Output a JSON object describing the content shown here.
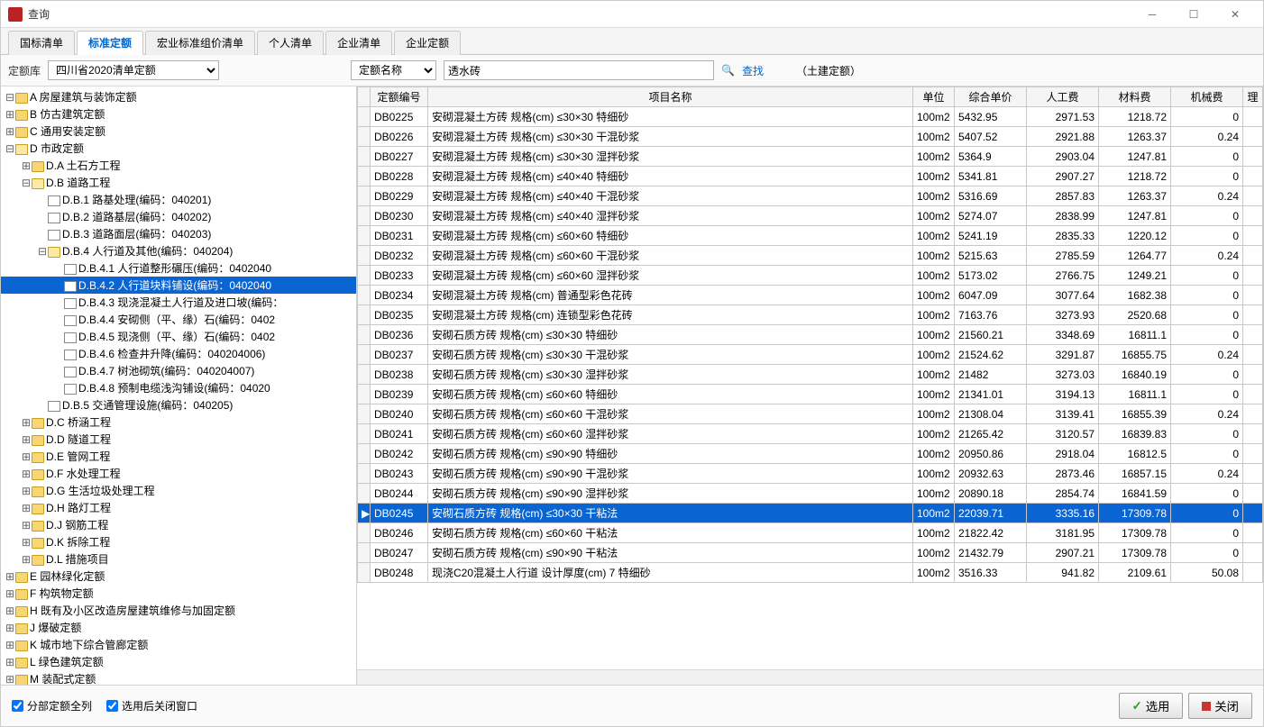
{
  "window": {
    "title": "查询"
  },
  "tabs": [
    "国标清单",
    "标准定额",
    "宏业标准组价清单",
    "个人清单",
    "企业清单",
    "企业定额"
  ],
  "activeTab": 1,
  "toolbar": {
    "left_label": "定额库",
    "library": "四川省2020清单定额",
    "filter_type": "定额名称",
    "filter_value": "透水砖",
    "search_label": "查找",
    "extra": "（土建定额）"
  },
  "tree": [
    {
      "indent": 0,
      "toggle": "-",
      "type": "folder",
      "label": "A 房屋建筑与装饰定额"
    },
    {
      "indent": 0,
      "toggle": "+",
      "type": "folder",
      "label": "B 仿古建筑定额"
    },
    {
      "indent": 0,
      "toggle": "+",
      "type": "folder",
      "label": "C 通用安装定额"
    },
    {
      "indent": 0,
      "toggle": "-",
      "type": "folder-open",
      "label": "D 市政定额"
    },
    {
      "indent": 1,
      "toggle": "+",
      "type": "folder",
      "label": "D.A 土石方工程"
    },
    {
      "indent": 1,
      "toggle": "-",
      "type": "folder-open",
      "label": "D.B 道路工程"
    },
    {
      "indent": 2,
      "toggle": "",
      "type": "doc",
      "label": "D.B.1 路基处理(编码：040201)"
    },
    {
      "indent": 2,
      "toggle": "",
      "type": "doc",
      "label": "D.B.2 道路基层(编码：040202)"
    },
    {
      "indent": 2,
      "toggle": "",
      "type": "doc",
      "label": "D.B.3 道路面层(编码：040203)"
    },
    {
      "indent": 2,
      "toggle": "-",
      "type": "folder-open",
      "label": "D.B.4 人行道及其他(编码：040204)"
    },
    {
      "indent": 3,
      "toggle": "",
      "type": "doc",
      "label": "D.B.4.1 人行道整形碾压(编码：0402040"
    },
    {
      "indent": 3,
      "toggle": "",
      "type": "doc",
      "label": "D.B.4.2 人行道块料铺设(编码：0402040",
      "selected": true
    },
    {
      "indent": 3,
      "toggle": "",
      "type": "doc",
      "label": "D.B.4.3 现浇混凝土人行道及进口坡(编码："
    },
    {
      "indent": 3,
      "toggle": "",
      "type": "doc",
      "label": "D.B.4.4 安砌侧（平、缘）石(编码：0402"
    },
    {
      "indent": 3,
      "toggle": "",
      "type": "doc",
      "label": "D.B.4.5 现浇侧（平、缘）石(编码：0402"
    },
    {
      "indent": 3,
      "toggle": "",
      "type": "doc",
      "label": "D.B.4.6 检查井升降(编码：040204006)"
    },
    {
      "indent": 3,
      "toggle": "",
      "type": "doc",
      "label": "D.B.4.7 树池砌筑(编码：040204007)"
    },
    {
      "indent": 3,
      "toggle": "",
      "type": "doc",
      "label": "D.B.4.8 预制电缆浅沟铺设(编码：04020"
    },
    {
      "indent": 2,
      "toggle": "",
      "type": "doc",
      "label": "D.B.5 交通管理设施(编码：040205)"
    },
    {
      "indent": 1,
      "toggle": "+",
      "type": "folder",
      "label": "D.C 桥涵工程"
    },
    {
      "indent": 1,
      "toggle": "+",
      "type": "folder",
      "label": "D.D 隧道工程"
    },
    {
      "indent": 1,
      "toggle": "+",
      "type": "folder",
      "label": "D.E 管网工程"
    },
    {
      "indent": 1,
      "toggle": "+",
      "type": "folder",
      "label": "D.F 水处理工程"
    },
    {
      "indent": 1,
      "toggle": "+",
      "type": "folder",
      "label": "D.G 生活垃圾处理工程"
    },
    {
      "indent": 1,
      "toggle": "+",
      "type": "folder",
      "label": "D.H 路灯工程"
    },
    {
      "indent": 1,
      "toggle": "+",
      "type": "folder",
      "label": "D.J 钢筋工程"
    },
    {
      "indent": 1,
      "toggle": "+",
      "type": "folder",
      "label": "D.K 拆除工程"
    },
    {
      "indent": 1,
      "toggle": "+",
      "type": "folder",
      "label": "D.L 措施项目"
    },
    {
      "indent": 0,
      "toggle": "+",
      "type": "folder",
      "label": "E 园林绿化定额"
    },
    {
      "indent": 0,
      "toggle": "+",
      "type": "folder",
      "label": "F 构筑物定额"
    },
    {
      "indent": 0,
      "toggle": "+",
      "type": "folder",
      "label": "H 既有及小区改造房屋建筑维修与加固定额"
    },
    {
      "indent": 0,
      "toggle": "+",
      "type": "folder",
      "label": "J 爆破定额"
    },
    {
      "indent": 0,
      "toggle": "+",
      "type": "folder",
      "label": "K 城市地下综合管廊定额"
    },
    {
      "indent": 0,
      "toggle": "+",
      "type": "folder",
      "label": "L 绿色建筑定额"
    },
    {
      "indent": 0,
      "toggle": "+",
      "type": "folder",
      "label": "M 装配式定额"
    }
  ],
  "table": {
    "headers": [
      "定额编号",
      "项目名称",
      "单位",
      "综合单价",
      "人工费",
      "材料费",
      "机械费",
      "理"
    ],
    "rows": [
      {
        "code": "DB0225",
        "name": "安砌混凝土方砖 规格(cm) ≤30×30 特细砂",
        "unit": "100m2",
        "price": "5432.95",
        "labor": "2971.53",
        "material": "1218.72",
        "machine": "0"
      },
      {
        "code": "DB0226",
        "name": "安砌混凝土方砖 规格(cm) ≤30×30 干混砂浆",
        "unit": "100m2",
        "price": "5407.52",
        "labor": "2921.88",
        "material": "1263.37",
        "machine": "0.24"
      },
      {
        "code": "DB0227",
        "name": "安砌混凝土方砖 规格(cm) ≤30×30 湿拌砂浆",
        "unit": "100m2",
        "price": "5364.9",
        "labor": "2903.04",
        "material": "1247.81",
        "machine": "0"
      },
      {
        "code": "DB0228",
        "name": "安砌混凝土方砖 规格(cm) ≤40×40 特细砂",
        "unit": "100m2",
        "price": "5341.81",
        "labor": "2907.27",
        "material": "1218.72",
        "machine": "0"
      },
      {
        "code": "DB0229",
        "name": "安砌混凝土方砖 规格(cm) ≤40×40 干混砂浆",
        "unit": "100m2",
        "price": "5316.69",
        "labor": "2857.83",
        "material": "1263.37",
        "machine": "0.24"
      },
      {
        "code": "DB0230",
        "name": "安砌混凝土方砖 规格(cm) ≤40×40 湿拌砂浆",
        "unit": "100m2",
        "price": "5274.07",
        "labor": "2838.99",
        "material": "1247.81",
        "machine": "0"
      },
      {
        "code": "DB0231",
        "name": "安砌混凝土方砖 规格(cm) ≤60×60 特细砂",
        "unit": "100m2",
        "price": "5241.19",
        "labor": "2835.33",
        "material": "1220.12",
        "machine": "0"
      },
      {
        "code": "DB0232",
        "name": "安砌混凝土方砖 规格(cm) ≤60×60 干混砂浆",
        "unit": "100m2",
        "price": "5215.63",
        "labor": "2785.59",
        "material": "1264.77",
        "machine": "0.24"
      },
      {
        "code": "DB0233",
        "name": "安砌混凝土方砖 规格(cm) ≤60×60 湿拌砂浆",
        "unit": "100m2",
        "price": "5173.02",
        "labor": "2766.75",
        "material": "1249.21",
        "machine": "0"
      },
      {
        "code": "DB0234",
        "name": "安砌混凝土方砖 规格(cm) 普通型彩色花砖",
        "unit": "100m2",
        "price": "6047.09",
        "labor": "3077.64",
        "material": "1682.38",
        "machine": "0"
      },
      {
        "code": "DB0235",
        "name": "安砌混凝土方砖 规格(cm) 连锁型彩色花砖",
        "unit": "100m2",
        "price": "7163.76",
        "labor": "3273.93",
        "material": "2520.68",
        "machine": "0"
      },
      {
        "code": "DB0236",
        "name": "安砌石质方砖 规格(cm) ≤30×30 特细砂",
        "unit": "100m2",
        "price": "21560.21",
        "labor": "3348.69",
        "material": "16811.1",
        "machine": "0"
      },
      {
        "code": "DB0237",
        "name": "安砌石质方砖 规格(cm) ≤30×30 干混砂浆",
        "unit": "100m2",
        "price": "21524.62",
        "labor": "3291.87",
        "material": "16855.75",
        "machine": "0.24"
      },
      {
        "code": "DB0238",
        "name": "安砌石质方砖 规格(cm) ≤30×30 湿拌砂浆",
        "unit": "100m2",
        "price": "21482",
        "labor": "3273.03",
        "material": "16840.19",
        "machine": "0"
      },
      {
        "code": "DB0239",
        "name": "安砌石质方砖 规格(cm) ≤60×60 特细砂",
        "unit": "100m2",
        "price": "21341.01",
        "labor": "3194.13",
        "material": "16811.1",
        "machine": "0"
      },
      {
        "code": "DB0240",
        "name": "安砌石质方砖 规格(cm) ≤60×60 干混砂浆",
        "unit": "100m2",
        "price": "21308.04",
        "labor": "3139.41",
        "material": "16855.39",
        "machine": "0.24"
      },
      {
        "code": "DB0241",
        "name": "安砌石质方砖 规格(cm) ≤60×60 湿拌砂浆",
        "unit": "100m2",
        "price": "21265.42",
        "labor": "3120.57",
        "material": "16839.83",
        "machine": "0"
      },
      {
        "code": "DB0242",
        "name": "安砌石质方砖 规格(cm) ≤90×90 特细砂",
        "unit": "100m2",
        "price": "20950.86",
        "labor": "2918.04",
        "material": "16812.5",
        "machine": "0"
      },
      {
        "code": "DB0243",
        "name": "安砌石质方砖 规格(cm) ≤90×90 干混砂浆",
        "unit": "100m2",
        "price": "20932.63",
        "labor": "2873.46",
        "material": "16857.15",
        "machine": "0.24"
      },
      {
        "code": "DB0244",
        "name": "安砌石质方砖 规格(cm) ≤90×90 湿拌砂浆",
        "unit": "100m2",
        "price": "20890.18",
        "labor": "2854.74",
        "material": "16841.59",
        "machine": "0"
      },
      {
        "code": "DB0245",
        "name": "安砌石质方砖 规格(cm) ≤30×30 干粘法",
        "unit": "100m2",
        "price": "22039.71",
        "labor": "3335.16",
        "material": "17309.78",
        "machine": "0",
        "selected": true
      },
      {
        "code": "DB0246",
        "name": "安砌石质方砖 规格(cm) ≤60×60 干粘法",
        "unit": "100m2",
        "price": "21822.42",
        "labor": "3181.95",
        "material": "17309.78",
        "machine": "0"
      },
      {
        "code": "DB0247",
        "name": "安砌石质方砖 规格(cm) ≤90×90 干粘法",
        "unit": "100m2",
        "price": "21432.79",
        "labor": "2907.21",
        "material": "17309.78",
        "machine": "0"
      },
      {
        "code": "DB0248",
        "name": "现浇C20混凝土人行道 设计厚度(cm) 7 特细砂",
        "unit": "100m2",
        "price": "3516.33",
        "labor": "941.82",
        "material": "2109.61",
        "machine": "50.08"
      }
    ]
  },
  "footer": {
    "chk1": "分部定额全列",
    "chk2": "选用后关闭窗口",
    "select_btn": "选用",
    "close_btn": "关闭"
  }
}
